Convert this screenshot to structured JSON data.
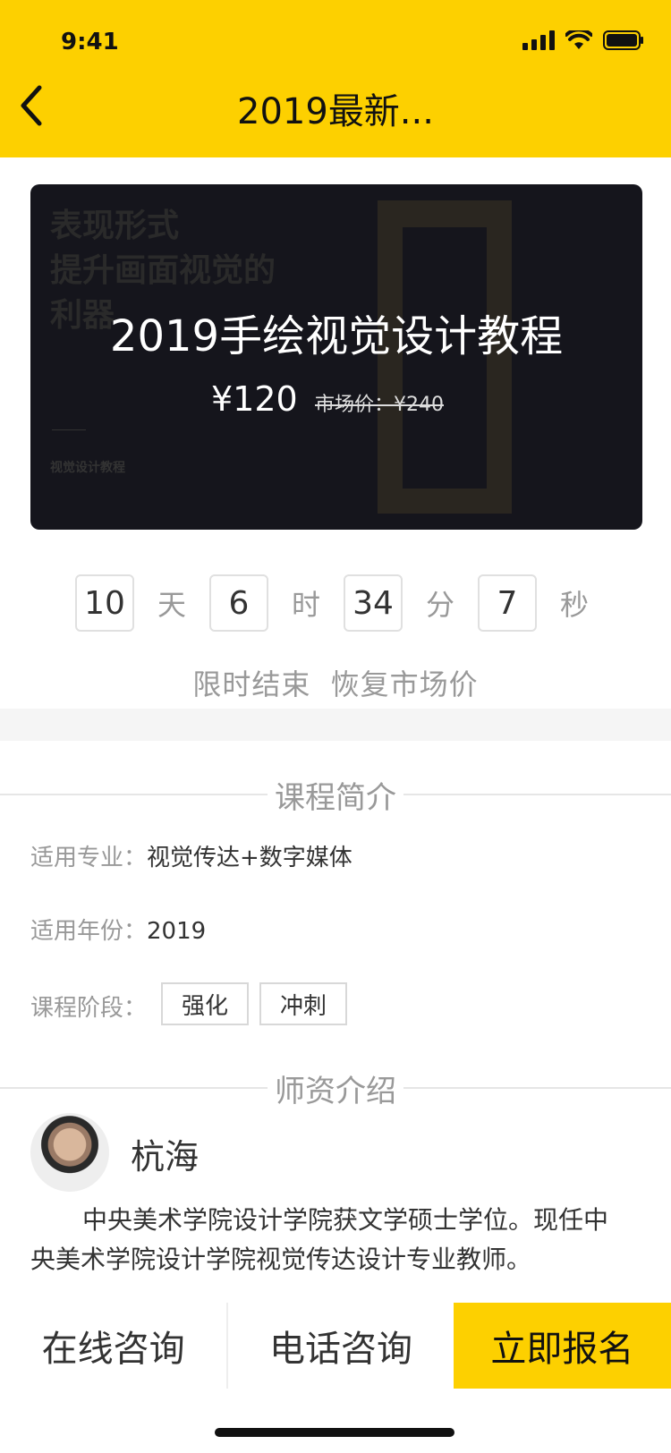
{
  "status_bar": {
    "time": "9:41"
  },
  "nav": {
    "title": "2019最新..."
  },
  "banner": {
    "title": "2019手绘视觉设计教程",
    "price": "¥120",
    "market_price": "市场价：¥240",
    "bg_text": "表现形式\n提升画面视觉的\n利器",
    "bg_sub": "视觉设计教程"
  },
  "countdown": {
    "days": "10",
    "days_unit": "天",
    "hours": "6",
    "hours_unit": "时",
    "minutes": "34",
    "minutes_unit": "分",
    "seconds": "7",
    "seconds_unit": "秒",
    "note": "限时结束  恢复市场价"
  },
  "course_intro": {
    "heading": "课程简介",
    "major_label": "适用专业：",
    "major_value": "视觉传达+数字媒体",
    "year_label": "适用年份：",
    "year_value": "2019",
    "stage_label": "课程阶段：",
    "stages": [
      "强化",
      "冲刺"
    ]
  },
  "teacher_intro": {
    "heading": "师资介绍",
    "name": "杭海",
    "bio": "中央美术学院设计学院获文学硕士学位。现任中央美术学院设计学院视觉传达设计专业教师。"
  },
  "bottom_bar": {
    "online": "在线咨询",
    "phone": "电话咨询",
    "signup": "立即报名"
  },
  "colors": {
    "accent": "#FDD000",
    "banner_bg": "#15151c"
  },
  "icons": [
    "back-icon",
    "signal-icon",
    "wifi-icon",
    "battery-icon"
  ]
}
